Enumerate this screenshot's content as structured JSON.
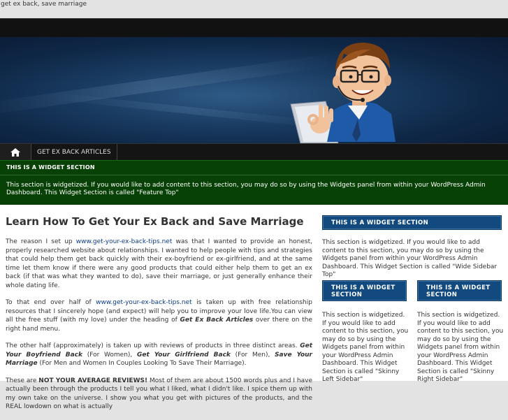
{
  "site": {
    "title": "get ex back, save marriage"
  },
  "nav": {
    "home_icon": "home-icon",
    "items": [
      {
        "label": "GET EX BACK ARTICLES"
      }
    ]
  },
  "feature_top": {
    "title": "THIS IS A WIDGET SECTION",
    "text": "This section is widgetized. If you would like to add content to this section, you may do so by using the Widgets panel from within your WordPress Admin Dashboard. This Widget Section is called \"Feature Top\""
  },
  "article": {
    "title": "Learn How To Get Your Ex Back and Save Marriage",
    "p1_before": "The reason I set up ",
    "p1_link": "www.get-your-ex-back-tips.net",
    "p1_after": " was that I wanted to provide an honest, properly researched website about relationships. I wanted to help people with tips and strategies that could help them get back quickly with their ex-boyfriend or ex-girlfriend, and at the same time let them know if there were any good products that could either help them to get an ex back (if that was what they wanted to do), save their marriage, or just generally enhance their whole dating life.",
    "p2_before": "To that end over half of ",
    "p2_link": "www.get-your-ex-back-tips.net",
    "p2_mid": " is taken up with free relationship resources that I sincerely hope (and expect) will help you to improve your love life.You can view all the free stuff (with my love) under the heading of ",
    "p2_bold": "Get Ex Back Articles",
    "p2_after": " over there on the right hand menu.",
    "p3_before": "The other half (approximately) is taken up with reviews of products in three distinct areas. ",
    "p3_b1": "Get Your Boyfriend Back",
    "p3_t1": " (For Women), ",
    "p3_b2": "Get Your Girlfriend Back",
    "p3_t2": " (For Men), ",
    "p3_b3": "Save Your Marriage",
    "p3_t3": " (For Men and Women In Couples Looking To Save Their Marriage).",
    "p4_before": "These are ",
    "p4_bold": "NOT YOUR AVERAGE REVIEWS!",
    "p4_after": " Most of them are about 1500 words plus and I have actually been through the products I tell you what I liked, what I didn't like. I spice them up with my own take on the universe. I show you what you get with pictures of the products, and the REAL lowdown on what is actually"
  },
  "sidebar": {
    "wide_top": {
      "title": "THIS IS A WIDGET SECTION",
      "text": "This section is widgetized. If you would like to add content to this section, you may do so by using the Widgets panel from within your WordPress Admin Dashboard. This Widget Section is called \"Wide Sidebar Top\""
    },
    "skinny_left": {
      "title": "THIS IS A WIDGET SECTION",
      "text": "This section is widgetized. If you would like to add content to this section, you may do so by using the Widgets panel from within your WordPress Admin Dashboard. This Widget Section is called \"Skinny Left Sidebar\""
    },
    "skinny_right": {
      "title": "THIS IS A WIDGET SECTION",
      "text": "This section is widgetized. If you would like to add content to this section, you may do so by using the Widgets panel from within your WordPress Admin Dashboard. This Widget Section is called \"Skinny Right Sidebar\""
    }
  },
  "colors": {
    "feature_bg": "#084105",
    "widget_head_bg": "#124a80",
    "link": "#0b3a8a",
    "nav_bg": "#141414"
  }
}
